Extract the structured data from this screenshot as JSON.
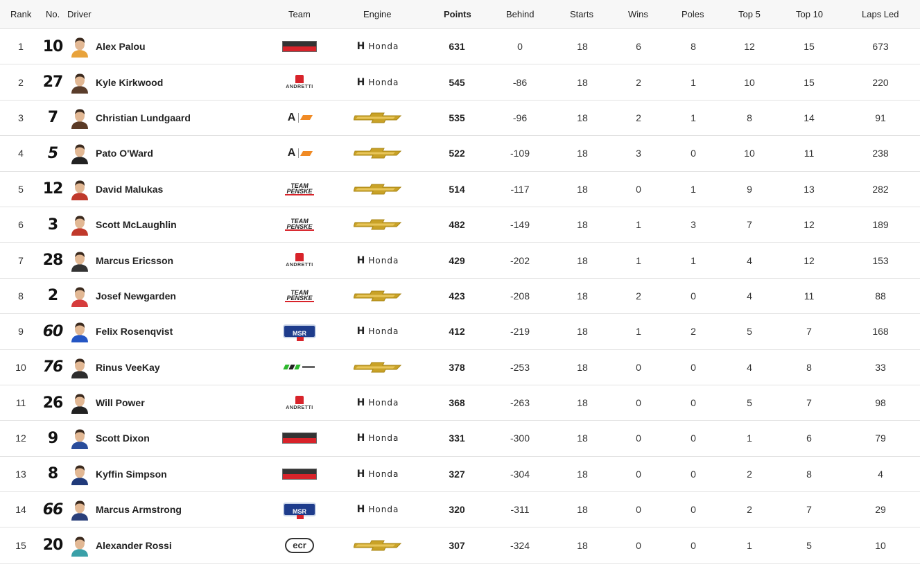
{
  "headers": {
    "rank": "Rank",
    "no": "No.",
    "driver": "Driver",
    "team": "Team",
    "engine": "Engine",
    "points": "Points",
    "behind": "Behind",
    "starts": "Starts",
    "wins": "Wins",
    "poles": "Poles",
    "top5": "Top 5",
    "top10": "Top 10",
    "laps_led": "Laps Led"
  },
  "rows": [
    {
      "rank": "1",
      "no": "10",
      "driver": "Alex Palou",
      "team": "ganassi",
      "team_text": "GANASSI RACING",
      "engine": "honda",
      "engine_text": "Honda",
      "points": "631",
      "behind": "0",
      "starts": "18",
      "wins": "6",
      "poles": "8",
      "top5": "12",
      "top10": "15",
      "laps_led": "673"
    },
    {
      "rank": "2",
      "no": "27",
      "driver": "Kyle Kirkwood",
      "team": "andretti",
      "team_text": "ANDRETTI",
      "engine": "honda",
      "engine_text": "Honda",
      "points": "545",
      "behind": "-86",
      "starts": "18",
      "wins": "2",
      "poles": "1",
      "top5": "10",
      "top10": "15",
      "laps_led": "220"
    },
    {
      "rank": "3",
      "no": "7",
      "driver": "Christian Lundgaard",
      "team": "amsp",
      "team_text": "A",
      "engine": "chevrolet",
      "engine_text": "",
      "points": "535",
      "behind": "-96",
      "starts": "18",
      "wins": "2",
      "poles": "1",
      "top5": "8",
      "top10": "14",
      "laps_led": "91"
    },
    {
      "rank": "4",
      "no": "5",
      "driver": "Pato O'Ward",
      "team": "amsp",
      "team_text": "A",
      "engine": "chevrolet",
      "engine_text": "",
      "points": "522",
      "behind": "-109",
      "starts": "18",
      "wins": "3",
      "poles": "0",
      "top5": "10",
      "top10": "11",
      "laps_led": "238"
    },
    {
      "rank": "5",
      "no": "12",
      "driver": "David Malukas",
      "team": "penske",
      "team_text": "TEAM PENSKE",
      "engine": "chevrolet",
      "engine_text": "",
      "points": "514",
      "behind": "-117",
      "starts": "18",
      "wins": "0",
      "poles": "1",
      "top5": "9",
      "top10": "13",
      "laps_led": "282"
    },
    {
      "rank": "6",
      "no": "3",
      "driver": "Scott McLaughlin",
      "team": "penske",
      "team_text": "TEAM PENSKE",
      "engine": "chevrolet",
      "engine_text": "",
      "points": "482",
      "behind": "-149",
      "starts": "18",
      "wins": "1",
      "poles": "3",
      "top5": "7",
      "top10": "12",
      "laps_led": "189"
    },
    {
      "rank": "7",
      "no": "28",
      "driver": "Marcus Ericsson",
      "team": "andretti",
      "team_text": "ANDRETTI",
      "engine": "honda",
      "engine_text": "Honda",
      "points": "429",
      "behind": "-202",
      "starts": "18",
      "wins": "1",
      "poles": "1",
      "top5": "4",
      "top10": "12",
      "laps_led": "153"
    },
    {
      "rank": "8",
      "no": "2",
      "driver": "Josef Newgarden",
      "team": "penske",
      "team_text": "TEAM PENSKE",
      "engine": "chevrolet",
      "engine_text": "",
      "points": "423",
      "behind": "-208",
      "starts": "18",
      "wins": "2",
      "poles": "0",
      "top5": "4",
      "top10": "11",
      "laps_led": "88"
    },
    {
      "rank": "9",
      "no": "60",
      "driver": "Felix Rosenqvist",
      "team": "msr",
      "team_text": "MSR",
      "engine": "honda",
      "engine_text": "Honda",
      "points": "412",
      "behind": "-219",
      "starts": "18",
      "wins": "1",
      "poles": "2",
      "top5": "5",
      "top10": "7",
      "laps_led": "168"
    },
    {
      "rank": "10",
      "no": "76",
      "driver": "Rinus VeeKay",
      "team": "meyer",
      "team_text": "",
      "engine": "chevrolet",
      "engine_text": "",
      "points": "378",
      "behind": "-253",
      "starts": "18",
      "wins": "0",
      "poles": "0",
      "top5": "4",
      "top10": "8",
      "laps_led": "33"
    },
    {
      "rank": "11",
      "no": "26",
      "driver": "Will Power",
      "team": "andretti",
      "team_text": "ANDRETTI",
      "engine": "honda",
      "engine_text": "Honda",
      "points": "368",
      "behind": "-263",
      "starts": "18",
      "wins": "0",
      "poles": "0",
      "top5": "5",
      "top10": "7",
      "laps_led": "98"
    },
    {
      "rank": "12",
      "no": "9",
      "driver": "Scott Dixon",
      "team": "ganassi",
      "team_text": "GANASSI RACING",
      "engine": "honda",
      "engine_text": "Honda",
      "points": "331",
      "behind": "-300",
      "starts": "18",
      "wins": "0",
      "poles": "0",
      "top5": "1",
      "top10": "6",
      "laps_led": "79"
    },
    {
      "rank": "13",
      "no": "8",
      "driver": "Kyffin Simpson",
      "team": "ganassi",
      "team_text": "GANASSI RACING",
      "engine": "honda",
      "engine_text": "Honda",
      "points": "327",
      "behind": "-304",
      "starts": "18",
      "wins": "0",
      "poles": "0",
      "top5": "2",
      "top10": "8",
      "laps_led": "4"
    },
    {
      "rank": "14",
      "no": "66",
      "driver": "Marcus Armstrong",
      "team": "msr",
      "team_text": "MSR",
      "engine": "honda",
      "engine_text": "Honda",
      "points": "320",
      "behind": "-311",
      "starts": "18",
      "wins": "0",
      "poles": "0",
      "top5": "2",
      "top10": "7",
      "laps_led": "29"
    },
    {
      "rank": "15",
      "no": "20",
      "driver": "Alexander Rossi",
      "team": "ecr",
      "team_text": "ecr",
      "engine": "chevrolet",
      "engine_text": "",
      "points": "307",
      "behind": "-324",
      "starts": "18",
      "wins": "0",
      "poles": "0",
      "top5": "1",
      "top10": "5",
      "laps_led": "10"
    }
  ],
  "avatar_colors": [
    "#e8a33c",
    "#5a3d2b",
    "#5b3a26",
    "#222222",
    "#c0392b",
    "#c0392b",
    "#333333",
    "#d63c3c",
    "#2556c4",
    "#2d2d2d",
    "#222222",
    "#2a4d9b",
    "#203a7a",
    "#2a3f7a",
    "#3aa0a8"
  ]
}
